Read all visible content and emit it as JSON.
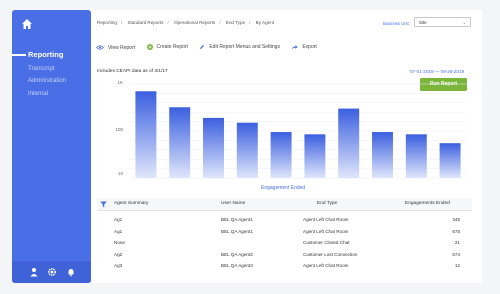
{
  "sidebar": {
    "items": [
      {
        "label": "Reporting"
      },
      {
        "label": "Transcript"
      },
      {
        "label": "Administration"
      },
      {
        "label": "Internal"
      }
    ],
    "bottom_icons": [
      "user-icon",
      "gear-icon",
      "bell-icon"
    ]
  },
  "header": {
    "breadcrumbs": [
      "Reporting",
      "Standard Reports",
      "Operational Reports",
      "End Type",
      "By Agent"
    ],
    "business_unit_label": "Business Unit:",
    "business_unit_value": "Site"
  },
  "toolbar": {
    "view_report": "View Report",
    "create_report": "Create Report",
    "edit_menus": "Edit Report Menus and Settings",
    "export": "Export"
  },
  "report": {
    "includes_text": "Includes CEAPI data as of 3/1/17",
    "date_range": "07-01-2019 — 09-26-2019",
    "run_button": "Run Report"
  },
  "chart_data": {
    "type": "bar",
    "scale": "log",
    "ylim": [
      10,
      1000
    ],
    "yticks": [
      "1K",
      "100",
      "10"
    ],
    "xlabel": "Engagement Ended",
    "values": [
      700,
      320,
      190,
      150,
      95,
      85,
      300,
      95,
      85,
      55
    ],
    "colors": {
      "bar_top": "#3b5fe0",
      "bar_bottom": "#dfe6fb"
    }
  },
  "table": {
    "columns": [
      "Agent Summary",
      "User Name",
      "End Type",
      "Engagements Ended"
    ],
    "rows": [
      {
        "agent": "Ag1",
        "user": "BEL QA Agent1",
        "end_type": "Agent Left Chat Room",
        "count": "345"
      },
      {
        "agent": "Ag1",
        "user": "BEL QA Agent1",
        "end_type": "Agent Left Chat Room",
        "count": "675"
      },
      {
        "agent": "None",
        "user": "",
        "end_type": "Customer Closed Chat",
        "count": "21"
      },
      {
        "agent": "Ag2",
        "user": "BEL QA Agent2",
        "end_type": "Customer Lost Connection",
        "count": "674"
      },
      {
        "agent": "Ag3",
        "user": "BEL QA Agent3",
        "end_type": "Agent Left Chat Room",
        "count": "12"
      }
    ]
  }
}
